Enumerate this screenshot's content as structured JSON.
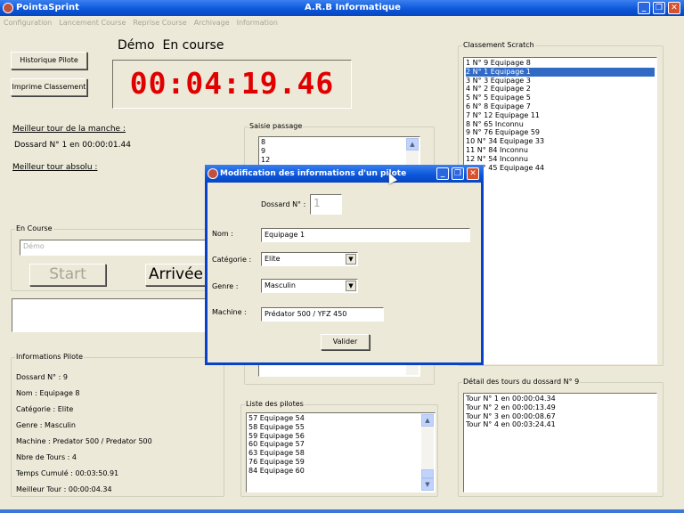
{
  "window": {
    "title": "PointaSprint",
    "company": "A.R.B Informatique"
  },
  "menu": [
    "Configuration",
    "Lancement Course",
    "Reprise Course",
    "Archivage",
    "Information"
  ],
  "buttons": {
    "historique": "Historique Pilote",
    "imprime": "Imprime Classement",
    "start": "Start",
    "arrivee": "Arrivée"
  },
  "status": "Démo  En course",
  "timer": "00:04:19.46",
  "colors": {
    "timer": "#e00000",
    "titlebar": "#0a55d8",
    "selection": "#316ac5"
  },
  "best": {
    "manche_label": "Meilleur tour de la manche :",
    "manche_value": "Dossard N° 1 en 00:00:01.44",
    "absolu_label": "Meilleur tour absolu :"
  },
  "en_course": {
    "legend": "En Course",
    "input_value": "Démo"
  },
  "info_pilote": {
    "legend": "Informations Pilote",
    "lines": [
      "Dossard N° : 9",
      "Nom : Equipage 8",
      "Catégorie : Elite",
      "Genre : Masculin",
      "Machine : Predator 500 / Predator 500",
      "Nbre de Tours : 4",
      "Temps Cumulé : 00:03:50.91",
      "Meilleur Tour : 00:00:04.34"
    ]
  },
  "saisie": {
    "legend": "Saisie passage",
    "items": [
      "8",
      "9",
      "12"
    ]
  },
  "liste_pilotes": {
    "legend": "Liste des pilotes",
    "items": [
      "57  Equipage 54",
      "58  Equipage 55",
      "59  Equipage 56",
      "60  Equipage 57",
      "63  Equipage 58",
      "76  Equipage 59",
      "84  Equipage 60"
    ]
  },
  "classement": {
    "legend": "Classement Scratch",
    "selected": 1,
    "items": [
      "1  N° 9  Equipage 8",
      "2  N° 1  Equipage 1",
      "3  N° 3  Equipage 3",
      "4  N° 2  Equipage 2",
      "5  N° 5  Equipage 5",
      "6  N° 8  Equipage 7",
      "7  N° 12  Equipage 11",
      "8  N° 65  Inconnu",
      "9  N° 76  Equipage 59",
      "10  N° 34  Equipage 33",
      "11  N° 84  Inconnu",
      "12  N° 54  Inconnu",
      "13  N° 45  Equipage 44"
    ]
  },
  "detail": {
    "legend": "Détail des tours du dossard N° 9",
    "items": [
      "Tour N° 1 en 00:00:04.34",
      "Tour N° 2 en 00:00:13.49",
      "Tour N° 3 en 00:00:08.67",
      "Tour N° 4 en 00:03:24.41"
    ]
  },
  "dialog": {
    "title": "Modification des informations d'un pilote",
    "dossard_label": "Dossard N° :",
    "dossard_value": "1",
    "nom_label": "Nom :",
    "nom_value": "Equipage 1",
    "categorie_label": "Catégorie :",
    "categorie_value": "Elite",
    "genre_label": "Genre :",
    "genre_value": "Masculin",
    "machine_label": "Machine :",
    "machine_value": "Prédator 500 / YFZ 450",
    "valider": "Valider"
  }
}
